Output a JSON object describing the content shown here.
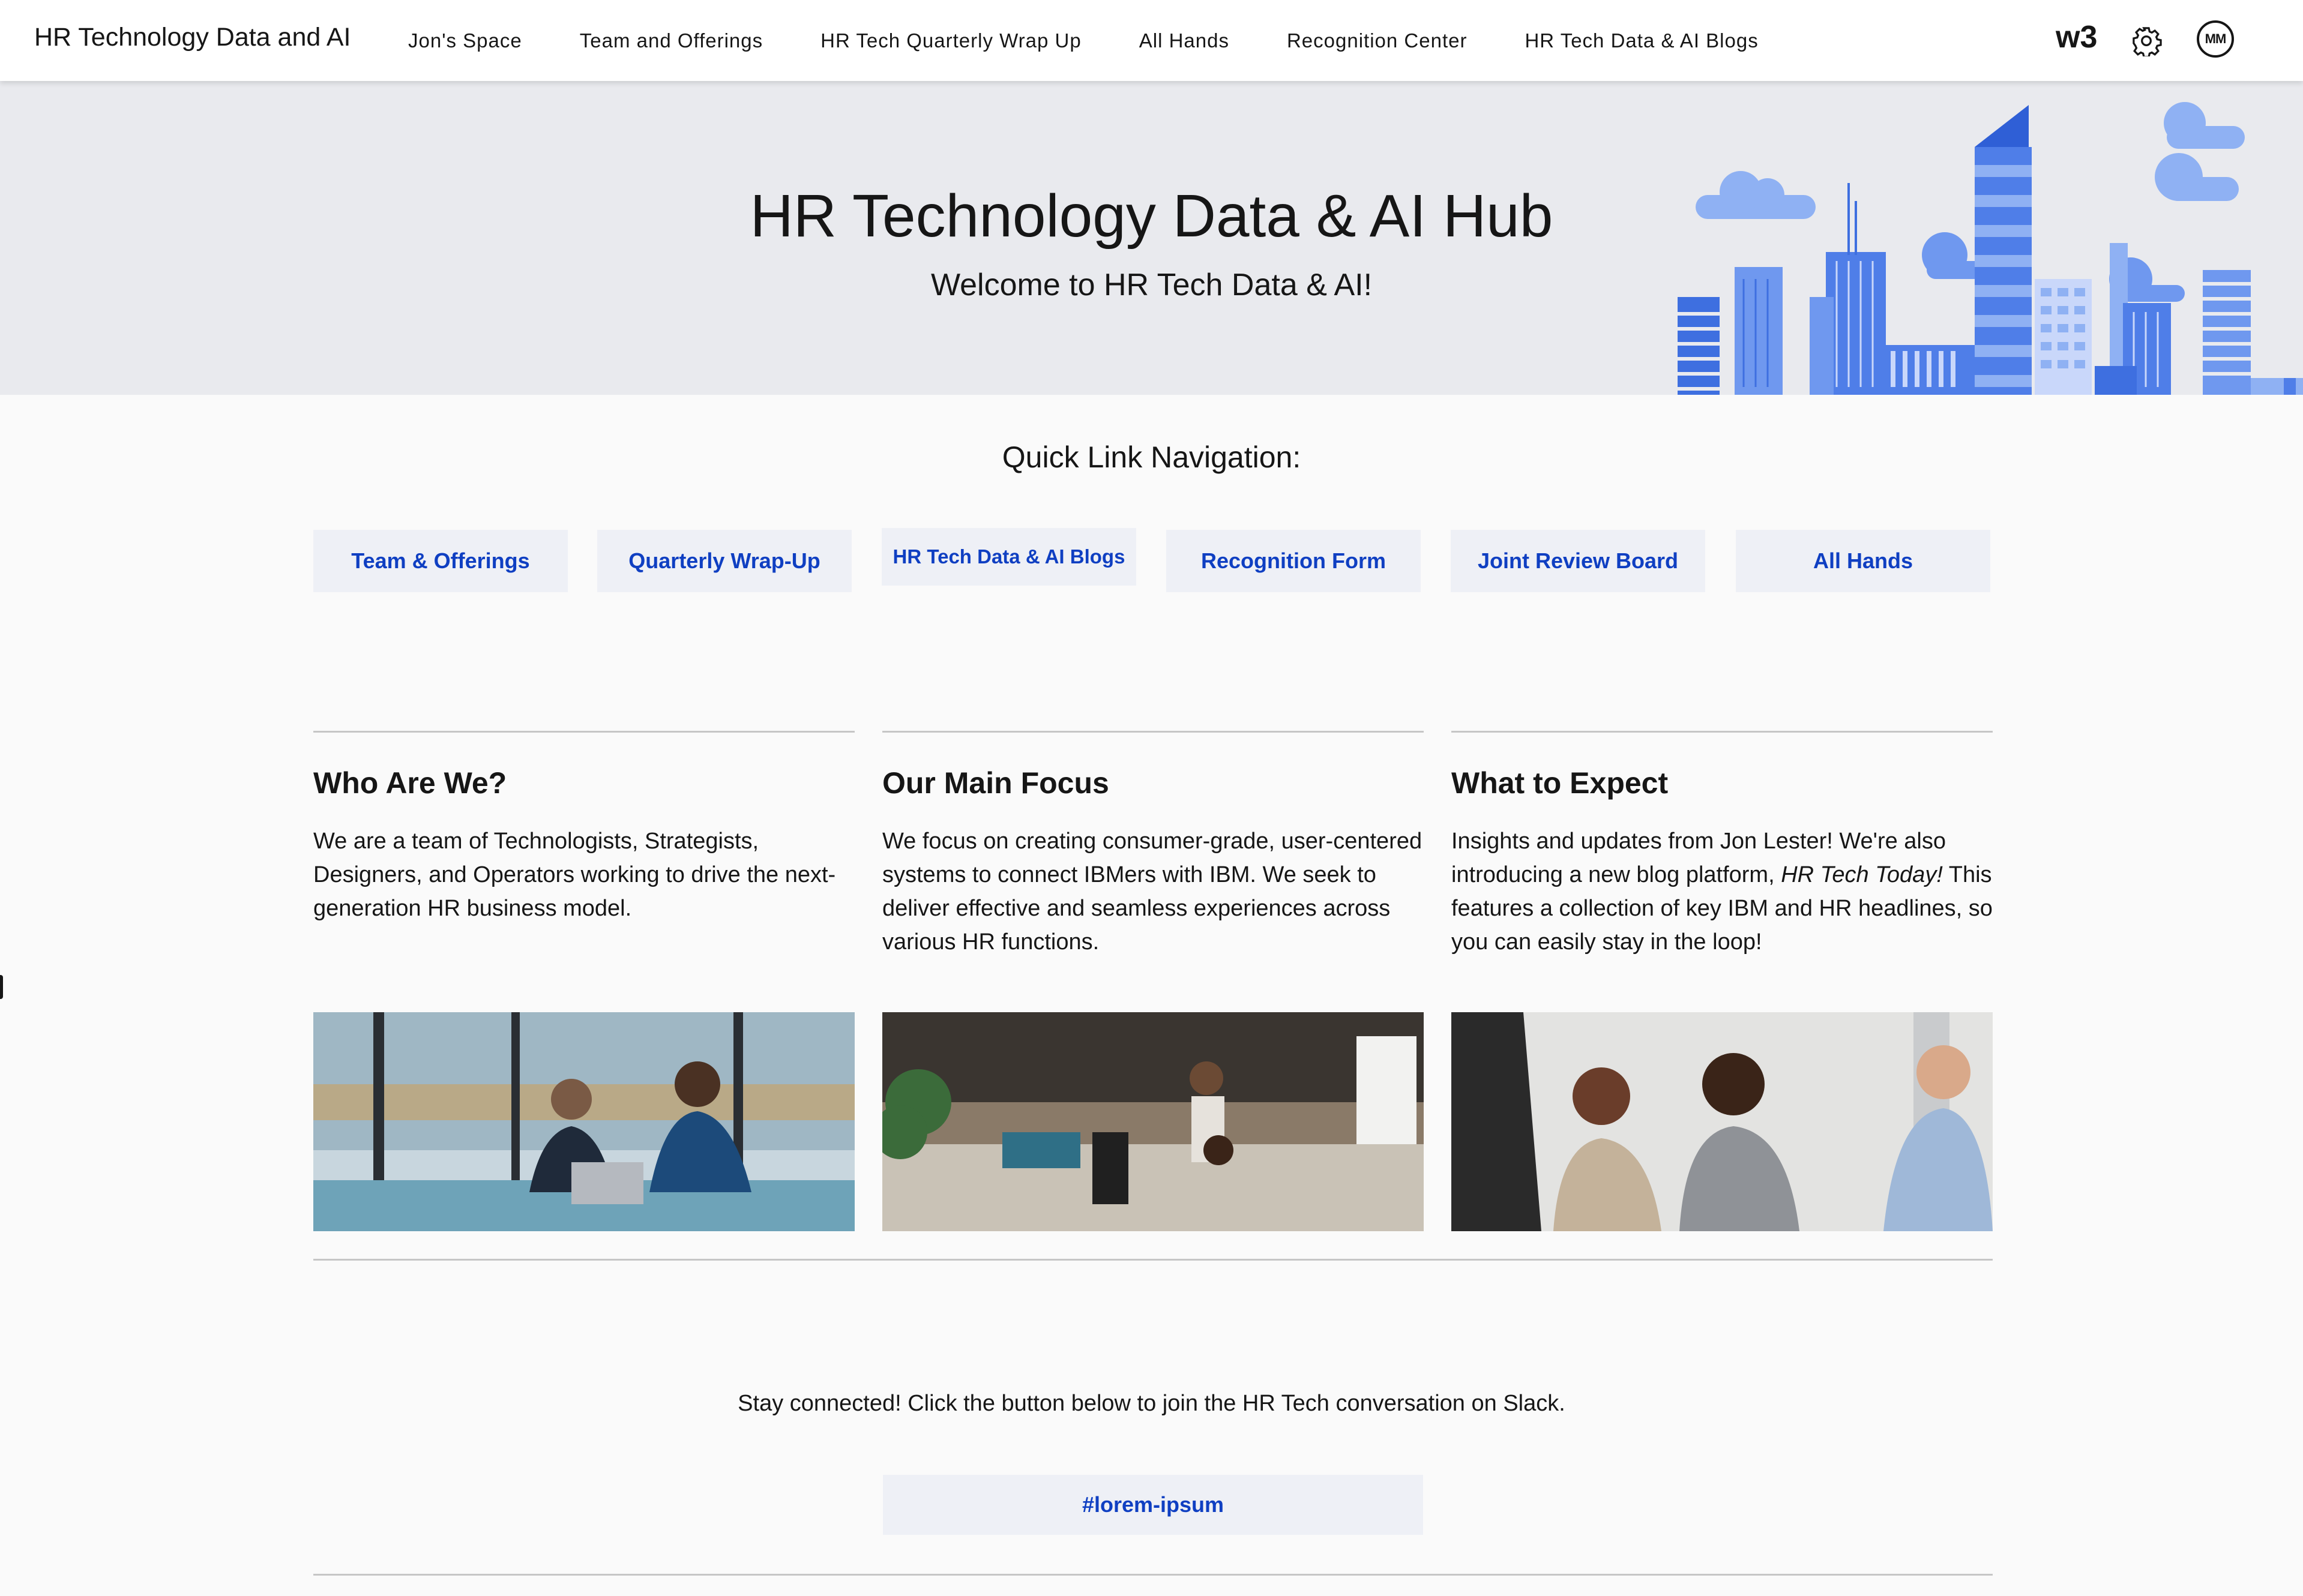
{
  "header": {
    "brand": "HR Technology Data and AI",
    "nav": [
      "Jon's Space",
      "Team and Offerings",
      "HR Tech Quarterly Wrap Up",
      "All Hands",
      "Recognition Center",
      "HR Tech Data & AI Blogs"
    ],
    "w3": "w3",
    "settings_icon": "gear-icon",
    "avatar_initials": "MM"
  },
  "hero": {
    "title": "HR Technology Data & AI Hub",
    "subtitle": "Welcome to HR Tech Data & AI!",
    "illustration": "city-skyline-illustration"
  },
  "quick_links": {
    "heading": "Quick Link Navigation:",
    "buttons": [
      "Team & Offerings",
      "Quarterly Wrap-Up",
      "HR Tech Data & AI Blogs",
      "Recognition Form",
      "Joint Review Board",
      "All Hands"
    ]
  },
  "columns": [
    {
      "title": "Who Are We?",
      "body": "We are a team of Technologists, Strategists, Designers, and Operators working to drive the next-generation HR business model."
    },
    {
      "title": "Our Main Focus",
      "body": "We focus on creating consumer-grade, user-centered systems to connect IBMers with IBM. We seek to deliver effective and seamless experiences across various HR functions."
    },
    {
      "title": "What to Expect",
      "body_before": "Insights and updates from Jon Lester! We're also introducing a new blog platform, ",
      "body_em": "HR Tech Today!",
      "body_after": " This features a collection of key IBM and HR headlines, so you can easily stay in the loop!"
    }
  ],
  "slack": {
    "text": "Stay connected! Click the button below to join the HR Tech conversation on Slack.",
    "button": "#lorem-ipsum"
  },
  "colors": {
    "link_blue": "#0f3fc2",
    "button_bg": "#eef0f6",
    "hero_bg": "#e9eaee",
    "skyline_blue": "#4f7ee8"
  }
}
